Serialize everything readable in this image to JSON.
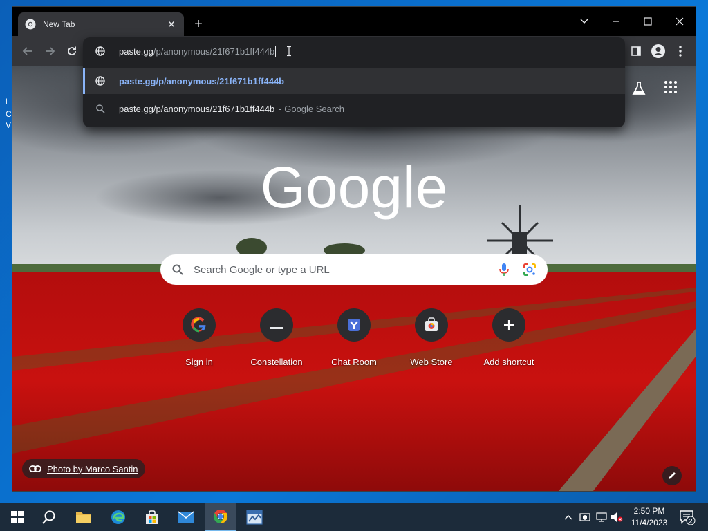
{
  "tab": {
    "title": "New Tab",
    "close": "✕",
    "new_tab": "+"
  },
  "window": {
    "minimize": "–",
    "maximize": "☐",
    "close": "✕",
    "tab_search": "⌄"
  },
  "omnibox": {
    "typed": "paste.gg",
    "autocomplete": "/p/anonymous/21f671b1ff444b"
  },
  "suggestions": {
    "first": "paste.gg/p/anonymous/21f671b1ff444b",
    "second": "paste.gg/p/anonymous/21f671b1ff444b",
    "second_suffix": "- Google Search"
  },
  "ntp": {
    "logo": "Google",
    "search_placeholder": "Search Google or type a URL",
    "shortcuts": [
      {
        "label": "Sign in",
        "icon": "google-g-icon"
      },
      {
        "label": "Constellation",
        "icon": "constellation-icon"
      },
      {
        "label": "Chat Room",
        "icon": "chat-room-icon"
      },
      {
        "label": "Web Store",
        "icon": "web-store-icon"
      },
      {
        "label": "Add shortcut",
        "icon": "plus-icon"
      }
    ],
    "photo_credit": "Photo by Marco Santin"
  },
  "taskbar": {
    "time": "2:50 PM",
    "date": "11/4/2023",
    "notification_count": "2"
  },
  "colors": {
    "accent_blue": "#8ab4f8",
    "chrome_dark": "#202124",
    "toolbar": "#35363a"
  }
}
